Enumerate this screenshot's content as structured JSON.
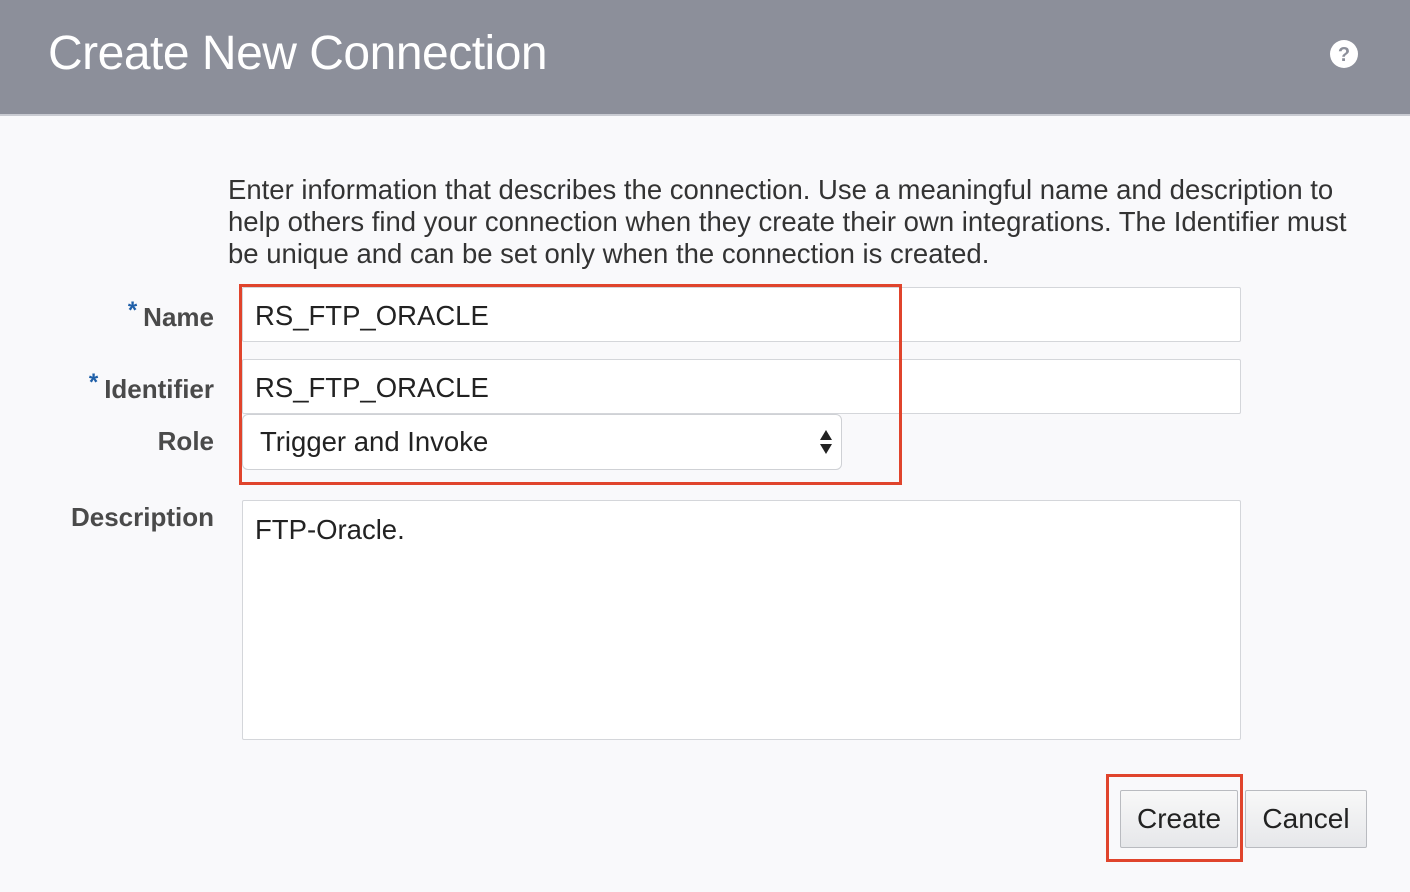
{
  "header": {
    "title": "Create New Connection",
    "help_icon": "help-circle-icon"
  },
  "intro_text": "Enter information that describes the connection. Use a meaningful name and description to help others find your connection when they create their own integrations. The Identifier must be unique and can be set only when the connection is created.",
  "form": {
    "required_marker": "*",
    "name": {
      "label": "Name",
      "value": "RS_FTP_ORACLE",
      "required": true
    },
    "identifier": {
      "label": "Identifier",
      "value": "RS_FTP_ORACLE",
      "required": true
    },
    "role": {
      "label": "Role",
      "selected": "Trigger and Invoke"
    },
    "description": {
      "label": "Description",
      "value": "FTP-Oracle."
    }
  },
  "buttons": {
    "create": "Create",
    "cancel": "Cancel"
  },
  "colors": {
    "header_bg": "#8c8f9a",
    "highlight": "#e0442c",
    "required_marker": "#1f5fa8"
  }
}
